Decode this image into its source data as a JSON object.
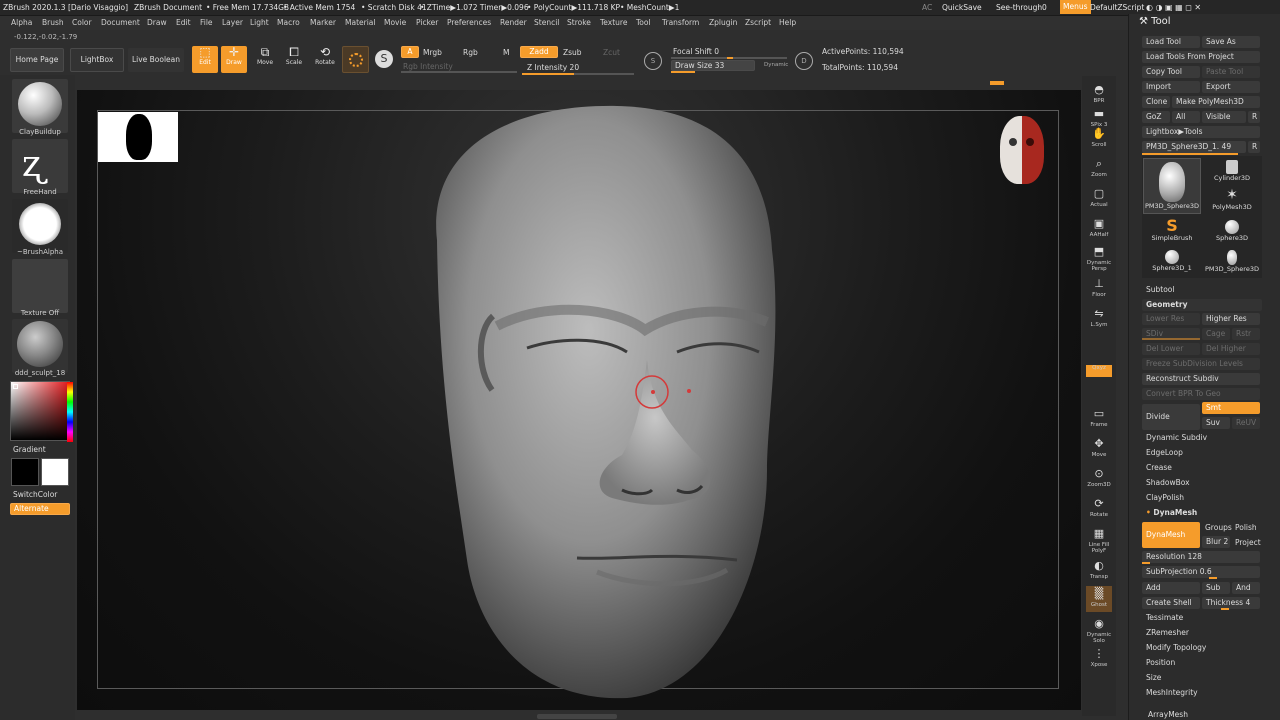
{
  "titlebar": {
    "app": "ZBrush 2020.1.3 [Dario Visaggio]",
    "doc": "ZBrush Document",
    "freemem": "• Free Mem 17.734GB",
    "activemem": "• Active Mem 1754",
    "scratch": "• Scratch Disk 41",
    "ztime": "• ZTime▶1.072 Timer▶0.096",
    "polycount": "• PolyCount▶111.718 KP",
    "meshcount": "• MeshCount▶1",
    "ac": "AC",
    "quicksave": "QuickSave",
    "seethrough": "See-through",
    "seethrough_val": "0",
    "menus": "Menus",
    "defaultzscript": "DefaultZScript"
  },
  "menubar": [
    "Alpha",
    "Brush",
    "Color",
    "Document",
    "Draw",
    "Edit",
    "File",
    "Layer",
    "Light",
    "Macro",
    "Marker",
    "Material",
    "Movie",
    "Picker",
    "Preferences",
    "Render",
    "Stencil",
    "Stroke",
    "Texture",
    "Tool",
    "Transform",
    "Zplugin",
    "Zscript",
    "Help"
  ],
  "coords": "-0.122,-0.02,-1.79",
  "toolbar": {
    "home": "Home Page",
    "lightbox": "LightBox",
    "liveboolean": "Live Boolean",
    "edit": "Edit",
    "draw": "Draw",
    "move": "Move",
    "scale": "Scale",
    "rotate": "Rotate",
    "a": "A",
    "mrgb": "Mrgb",
    "rgb": "Rgb",
    "m": "M",
    "rgb_intensity": "Rgb Intensity",
    "zadd": "Zadd",
    "zsub": "Zsub",
    "zcut": "Zcut",
    "z_intensity": "Z Intensity 20",
    "focal_shift": "Focal Shift 0",
    "draw_size": "Draw Size 33",
    "dynamic": "Dynamic",
    "active_points": "ActivePoints: 110,594",
    "total_points": "TotalPoints: 110,594"
  },
  "leftshelf": {
    "brush": "ClayBuildup",
    "stroke": "FreeHand",
    "alpha": "~BrushAlpha",
    "texture": "Texture Off",
    "material": "ddd_sculpt_18",
    "gradient": "Gradient",
    "switchcolor": "SwitchColor",
    "alternate": "Alternate"
  },
  "rightshelf": [
    "BPR",
    "SPix 3",
    "Scroll",
    "Zoom",
    "Actual",
    "AAHalf",
    "Dynamic Persp",
    "Floor",
    "L.Sym",
    "Qxyz",
    "Frame",
    "Move",
    "Zoom3D",
    "Rotate",
    "Line Fill PolyF",
    "Transp",
    "Ghost",
    "Dynamic Solo",
    "Xpose"
  ],
  "tray": {
    "title": "Tool",
    "row1": [
      "Load Tool",
      "Save As"
    ],
    "loadfromproject": "Load Tools From Project",
    "row3": [
      "Copy Tool",
      "Paste Tool"
    ],
    "row4": [
      "Import",
      "Export"
    ],
    "row5": [
      "Clone",
      "Make PolyMesh3D"
    ],
    "row6": [
      "GoZ",
      "All",
      "Visible",
      "R"
    ],
    "lightboxtools": "Lightbox▶Tools",
    "current": "PM3D_Sphere3D_1. 49",
    "current_r": "R",
    "tools": [
      "PM3D_Sphere3D",
      "Cylinder3D",
      "PolyMesh3D",
      "SimpleBrush",
      "Sphere3D",
      "Sphere3D_1",
      "PM3D_Sphere3D"
    ],
    "subtool": "Subtool",
    "geometry": "Geometry",
    "lowerres": "Lower Res",
    "higherres": "Higher Res",
    "sdiv": "SDiv",
    "cage": "Cage",
    "rstr": "Rstr",
    "dellower": "Del Lower",
    "delhigher": "Del Higher",
    "freeze": "Freeze SubDivision Levels",
    "reconstruct": "Reconstruct Subdiv",
    "convertbpr": "Convert BPR To Geo",
    "divide": "Divide",
    "smt": "Smt",
    "suv": "Suv",
    "reuv": "ReUV",
    "list1": [
      "Dynamic Subdiv",
      "EdgeLoop",
      "Crease",
      "ShadowBox",
      "ClayPolish"
    ],
    "dynamesh_section": "DynaMesh",
    "dynamesh_btn": "DynaMesh",
    "groups": "Groups",
    "polish": "Polish",
    "blur": "Blur 2",
    "project": "Project",
    "resolution": "Resolution 128",
    "subprojection": "SubProjection 0.6",
    "add": "Add",
    "sub": "Sub",
    "and": "And",
    "createshell": "Create Shell",
    "thickness": "Thickness 4",
    "list2": [
      "Tessimate",
      "ZRemesher",
      "Modify Topology",
      "Position",
      "Size",
      "MeshIntegrity"
    ],
    "arraymesh": "ArrayMesh"
  },
  "colors": {
    "accent": "#f59c2b",
    "viewport_bg": "#1a1a1a",
    "panel": "#2e2e2e"
  }
}
